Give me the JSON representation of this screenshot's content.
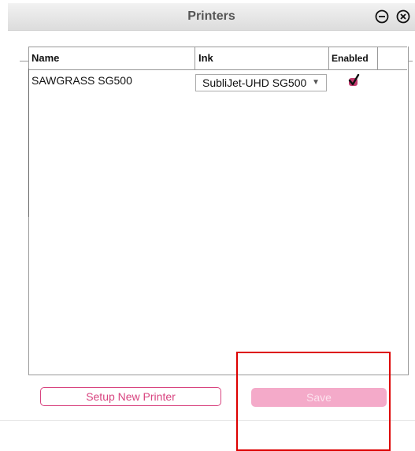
{
  "window": {
    "title": "Printers",
    "icons": {
      "minimize": "minus-circle-icon",
      "close": "close-circle-icon"
    }
  },
  "table": {
    "columns": [
      "Name",
      "Ink",
      "Enabled",
      ""
    ],
    "rows": [
      {
        "name": "SAWGRASS SG500",
        "ink": "SubliJet-UHD SG500",
        "enabled": true
      }
    ]
  },
  "buttons": {
    "setup": "Setup New Printer",
    "save": "Save"
  },
  "colors": {
    "accent": "#d8437f",
    "save_disabled": "#f4aac9",
    "annotation": "#dd0000"
  }
}
